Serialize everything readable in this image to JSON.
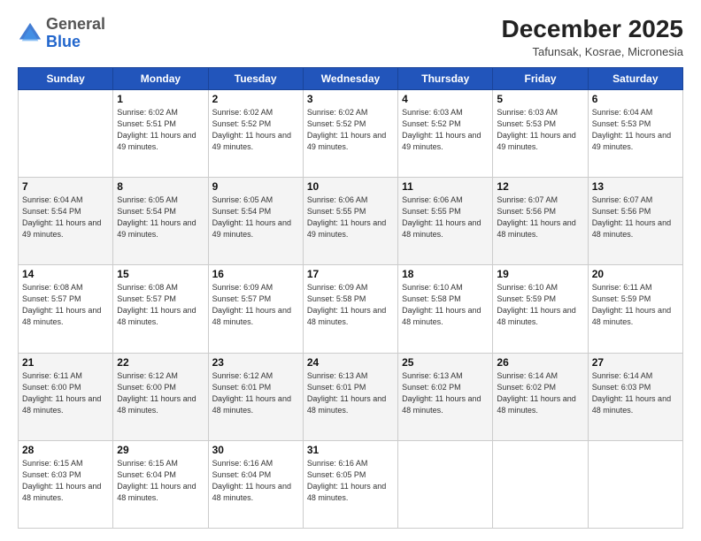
{
  "header": {
    "logo_general": "General",
    "logo_blue": "Blue",
    "main_title": "December 2025",
    "subtitle": "Tafunsak, Kosrae, Micronesia"
  },
  "days_of_week": [
    "Sunday",
    "Monday",
    "Tuesday",
    "Wednesday",
    "Thursday",
    "Friday",
    "Saturday"
  ],
  "weeks": [
    [
      {
        "day": "",
        "sunrise": "",
        "sunset": "",
        "daylight": ""
      },
      {
        "day": "1",
        "sunrise": "Sunrise: 6:02 AM",
        "sunset": "Sunset: 5:51 PM",
        "daylight": "Daylight: 11 hours and 49 minutes."
      },
      {
        "day": "2",
        "sunrise": "Sunrise: 6:02 AM",
        "sunset": "Sunset: 5:52 PM",
        "daylight": "Daylight: 11 hours and 49 minutes."
      },
      {
        "day": "3",
        "sunrise": "Sunrise: 6:02 AM",
        "sunset": "Sunset: 5:52 PM",
        "daylight": "Daylight: 11 hours and 49 minutes."
      },
      {
        "day": "4",
        "sunrise": "Sunrise: 6:03 AM",
        "sunset": "Sunset: 5:52 PM",
        "daylight": "Daylight: 11 hours and 49 minutes."
      },
      {
        "day": "5",
        "sunrise": "Sunrise: 6:03 AM",
        "sunset": "Sunset: 5:53 PM",
        "daylight": "Daylight: 11 hours and 49 minutes."
      },
      {
        "day": "6",
        "sunrise": "Sunrise: 6:04 AM",
        "sunset": "Sunset: 5:53 PM",
        "daylight": "Daylight: 11 hours and 49 minutes."
      }
    ],
    [
      {
        "day": "7",
        "sunrise": "Sunrise: 6:04 AM",
        "sunset": "Sunset: 5:54 PM",
        "daylight": "Daylight: 11 hours and 49 minutes."
      },
      {
        "day": "8",
        "sunrise": "Sunrise: 6:05 AM",
        "sunset": "Sunset: 5:54 PM",
        "daylight": "Daylight: 11 hours and 49 minutes."
      },
      {
        "day": "9",
        "sunrise": "Sunrise: 6:05 AM",
        "sunset": "Sunset: 5:54 PM",
        "daylight": "Daylight: 11 hours and 49 minutes."
      },
      {
        "day": "10",
        "sunrise": "Sunrise: 6:06 AM",
        "sunset": "Sunset: 5:55 PM",
        "daylight": "Daylight: 11 hours and 49 minutes."
      },
      {
        "day": "11",
        "sunrise": "Sunrise: 6:06 AM",
        "sunset": "Sunset: 5:55 PM",
        "daylight": "Daylight: 11 hours and 48 minutes."
      },
      {
        "day": "12",
        "sunrise": "Sunrise: 6:07 AM",
        "sunset": "Sunset: 5:56 PM",
        "daylight": "Daylight: 11 hours and 48 minutes."
      },
      {
        "day": "13",
        "sunrise": "Sunrise: 6:07 AM",
        "sunset": "Sunset: 5:56 PM",
        "daylight": "Daylight: 11 hours and 48 minutes."
      }
    ],
    [
      {
        "day": "14",
        "sunrise": "Sunrise: 6:08 AM",
        "sunset": "Sunset: 5:57 PM",
        "daylight": "Daylight: 11 hours and 48 minutes."
      },
      {
        "day": "15",
        "sunrise": "Sunrise: 6:08 AM",
        "sunset": "Sunset: 5:57 PM",
        "daylight": "Daylight: 11 hours and 48 minutes."
      },
      {
        "day": "16",
        "sunrise": "Sunrise: 6:09 AM",
        "sunset": "Sunset: 5:57 PM",
        "daylight": "Daylight: 11 hours and 48 minutes."
      },
      {
        "day": "17",
        "sunrise": "Sunrise: 6:09 AM",
        "sunset": "Sunset: 5:58 PM",
        "daylight": "Daylight: 11 hours and 48 minutes."
      },
      {
        "day": "18",
        "sunrise": "Sunrise: 6:10 AM",
        "sunset": "Sunset: 5:58 PM",
        "daylight": "Daylight: 11 hours and 48 minutes."
      },
      {
        "day": "19",
        "sunrise": "Sunrise: 6:10 AM",
        "sunset": "Sunset: 5:59 PM",
        "daylight": "Daylight: 11 hours and 48 minutes."
      },
      {
        "day": "20",
        "sunrise": "Sunrise: 6:11 AM",
        "sunset": "Sunset: 5:59 PM",
        "daylight": "Daylight: 11 hours and 48 minutes."
      }
    ],
    [
      {
        "day": "21",
        "sunrise": "Sunrise: 6:11 AM",
        "sunset": "Sunset: 6:00 PM",
        "daylight": "Daylight: 11 hours and 48 minutes."
      },
      {
        "day": "22",
        "sunrise": "Sunrise: 6:12 AM",
        "sunset": "Sunset: 6:00 PM",
        "daylight": "Daylight: 11 hours and 48 minutes."
      },
      {
        "day": "23",
        "sunrise": "Sunrise: 6:12 AM",
        "sunset": "Sunset: 6:01 PM",
        "daylight": "Daylight: 11 hours and 48 minutes."
      },
      {
        "day": "24",
        "sunrise": "Sunrise: 6:13 AM",
        "sunset": "Sunset: 6:01 PM",
        "daylight": "Daylight: 11 hours and 48 minutes."
      },
      {
        "day": "25",
        "sunrise": "Sunrise: 6:13 AM",
        "sunset": "Sunset: 6:02 PM",
        "daylight": "Daylight: 11 hours and 48 minutes."
      },
      {
        "day": "26",
        "sunrise": "Sunrise: 6:14 AM",
        "sunset": "Sunset: 6:02 PM",
        "daylight": "Daylight: 11 hours and 48 minutes."
      },
      {
        "day": "27",
        "sunrise": "Sunrise: 6:14 AM",
        "sunset": "Sunset: 6:03 PM",
        "daylight": "Daylight: 11 hours and 48 minutes."
      }
    ],
    [
      {
        "day": "28",
        "sunrise": "Sunrise: 6:15 AM",
        "sunset": "Sunset: 6:03 PM",
        "daylight": "Daylight: 11 hours and 48 minutes."
      },
      {
        "day": "29",
        "sunrise": "Sunrise: 6:15 AM",
        "sunset": "Sunset: 6:04 PM",
        "daylight": "Daylight: 11 hours and 48 minutes."
      },
      {
        "day": "30",
        "sunrise": "Sunrise: 6:16 AM",
        "sunset": "Sunset: 6:04 PM",
        "daylight": "Daylight: 11 hours and 48 minutes."
      },
      {
        "day": "31",
        "sunrise": "Sunrise: 6:16 AM",
        "sunset": "Sunset: 6:05 PM",
        "daylight": "Daylight: 11 hours and 48 minutes."
      },
      {
        "day": "",
        "sunrise": "",
        "sunset": "",
        "daylight": ""
      },
      {
        "day": "",
        "sunrise": "",
        "sunset": "",
        "daylight": ""
      },
      {
        "day": "",
        "sunrise": "",
        "sunset": "",
        "daylight": ""
      }
    ]
  ]
}
